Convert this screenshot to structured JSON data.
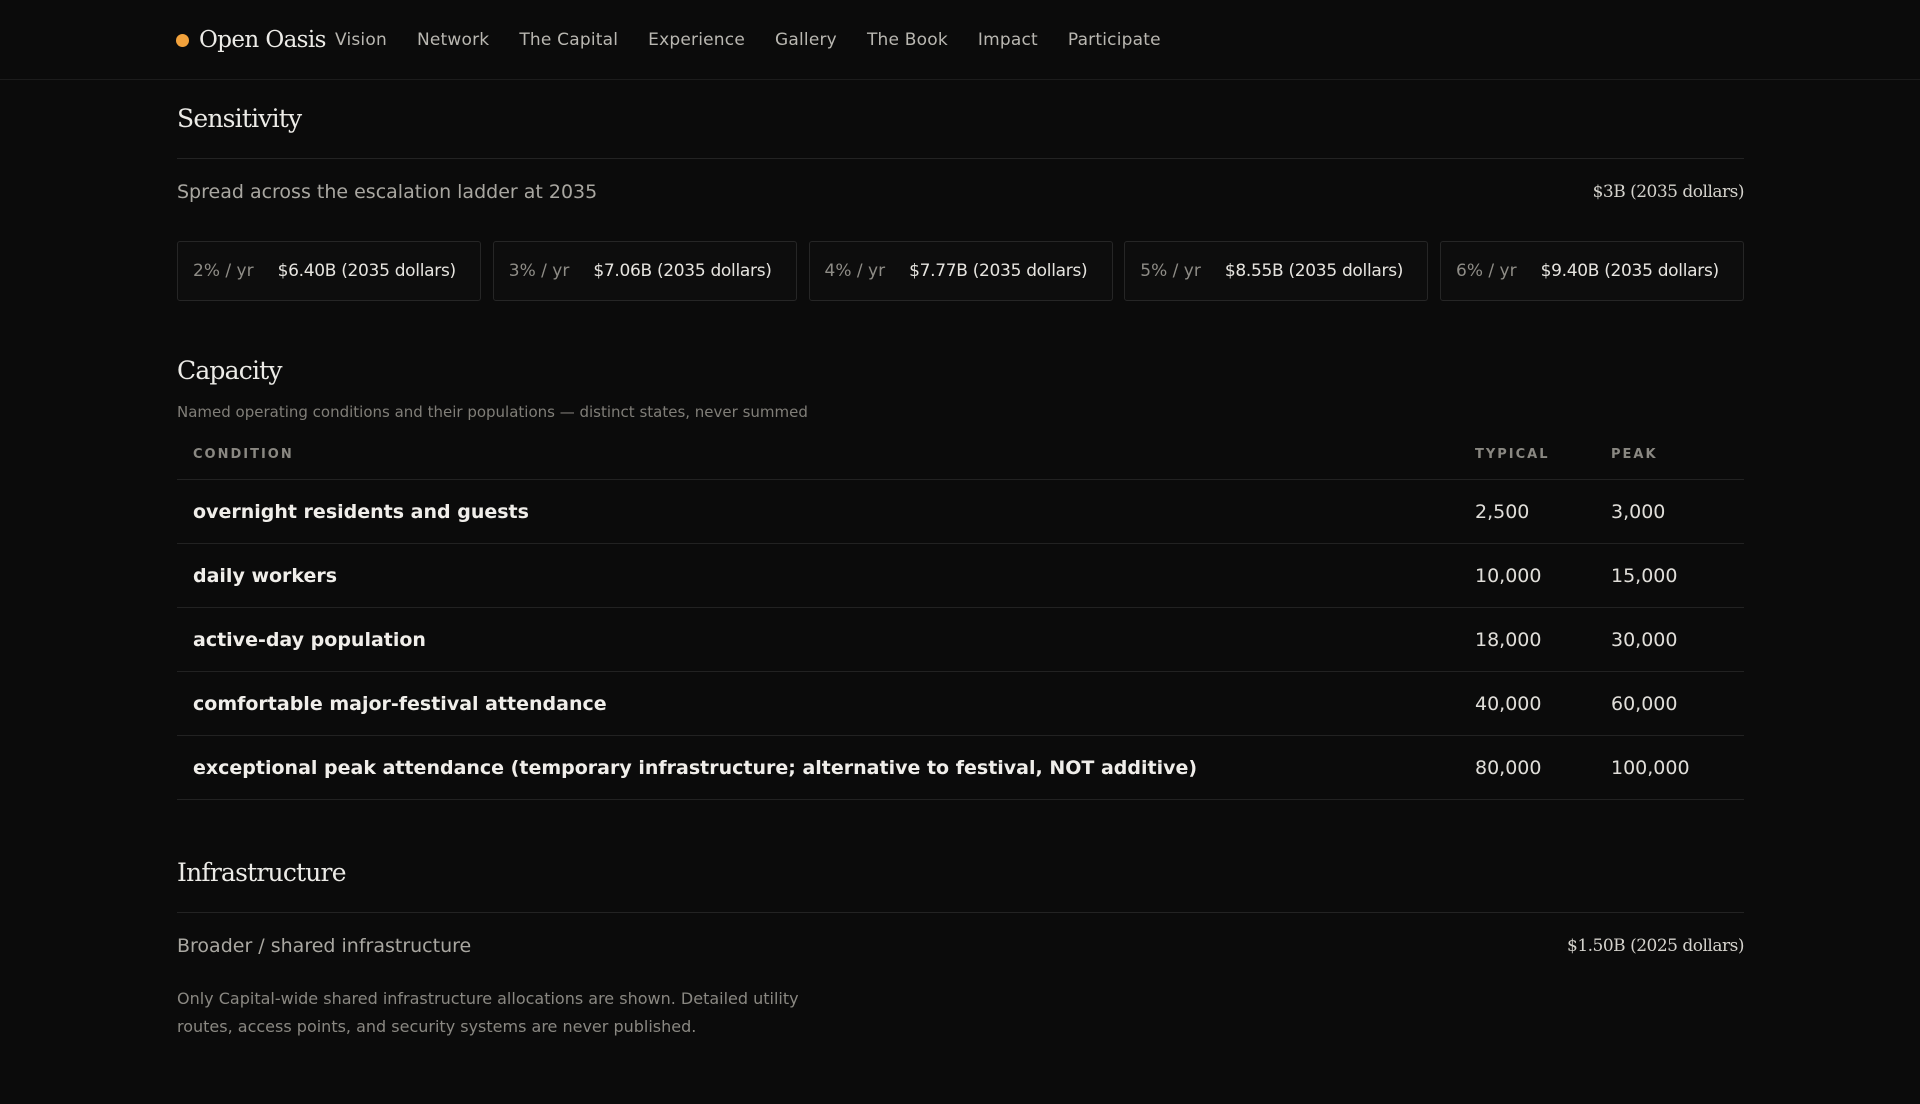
{
  "brand": {
    "name": "Open Oasis",
    "dot_color": "#f2a23c"
  },
  "nav": [
    {
      "label": "Vision"
    },
    {
      "label": "Network"
    },
    {
      "label": "The Capital"
    },
    {
      "label": "Experience"
    },
    {
      "label": "Gallery"
    },
    {
      "label": "The Book"
    },
    {
      "label": "Impact"
    },
    {
      "label": "Participate"
    }
  ],
  "sensitivity": {
    "title": "Sensitivity",
    "label": "Spread across the escalation ladder at 2035",
    "value": "$3B (2035 dollars)",
    "cards": [
      {
        "rate": "2% / yr",
        "value": "$6.40B (2035 dollars)"
      },
      {
        "rate": "3% / yr",
        "value": "$7.06B (2035 dollars)"
      },
      {
        "rate": "4% / yr",
        "value": "$7.77B (2035 dollars)"
      },
      {
        "rate": "5% / yr",
        "value": "$8.55B (2035 dollars)"
      },
      {
        "rate": "6% / yr",
        "value": "$9.40B (2035 dollars)"
      }
    ]
  },
  "capacity": {
    "title": "Capacity",
    "subtitle": "Named operating conditions and their populations — distinct states, never summed",
    "headers": {
      "condition": "CONDITION",
      "typical": "TYPICAL",
      "peak": "PEAK"
    },
    "rows": [
      {
        "condition": "overnight residents and guests",
        "typical": "2,500",
        "peak": "3,000"
      },
      {
        "condition": "daily workers",
        "typical": "10,000",
        "peak": "15,000"
      },
      {
        "condition": "active-day population",
        "typical": "18,000",
        "peak": "30,000"
      },
      {
        "condition": "comfortable major-festival attendance",
        "typical": "40,000",
        "peak": "60,000"
      },
      {
        "condition": "exceptional peak attendance (temporary infrastructure; alternative to festival, NOT additive)",
        "typical": "80,000",
        "peak": "100,000"
      }
    ]
  },
  "infrastructure": {
    "title": "Infrastructure",
    "label": "Broader / shared infrastructure",
    "value": "$1.50B (2025 dollars)",
    "note": "Only Capital-wide shared infrastructure allocations are shown. Detailed utility routes, access points, and security systems are never published."
  }
}
